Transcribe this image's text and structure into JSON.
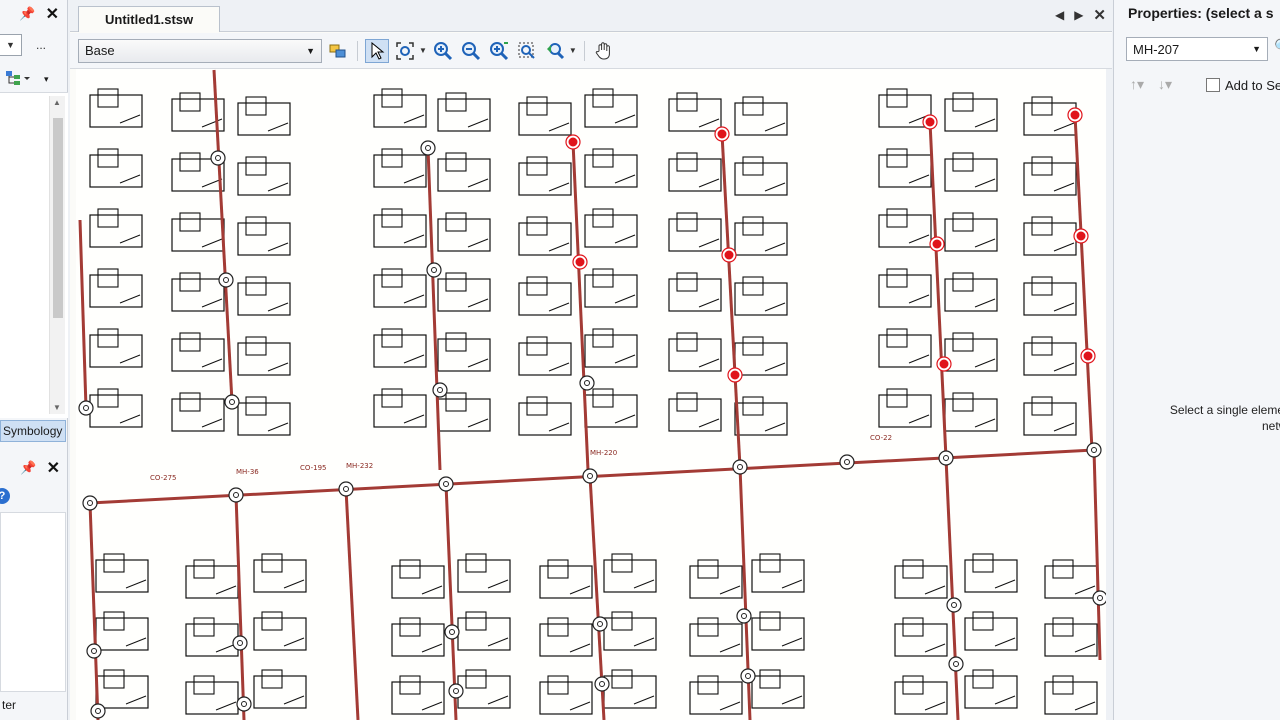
{
  "left_panel": {
    "more_label": "...",
    "tab_symbology": "Symbology",
    "help_label": "?",
    "bottom_text": "ter"
  },
  "document": {
    "tab_title": "Untitled1.stsw",
    "layer_select_value": "Base"
  },
  "properties": {
    "title": "Properties: (select a s",
    "element_value": "MH-207",
    "add_to_selection_label": "Add to Se",
    "message_line1": "Select a single element",
    "message_line2": "netwo"
  },
  "map": {
    "labels": [
      "MH-220",
      "MH-232",
      "MH-36",
      "CO-275",
      "CO-195",
      "CO-22"
    ]
  },
  "colors": {
    "pipe": "#a33b35",
    "selected_node": "#e0141b",
    "panel_bg": "#f4f6f9",
    "accent_tab": "#cfe0f4"
  }
}
